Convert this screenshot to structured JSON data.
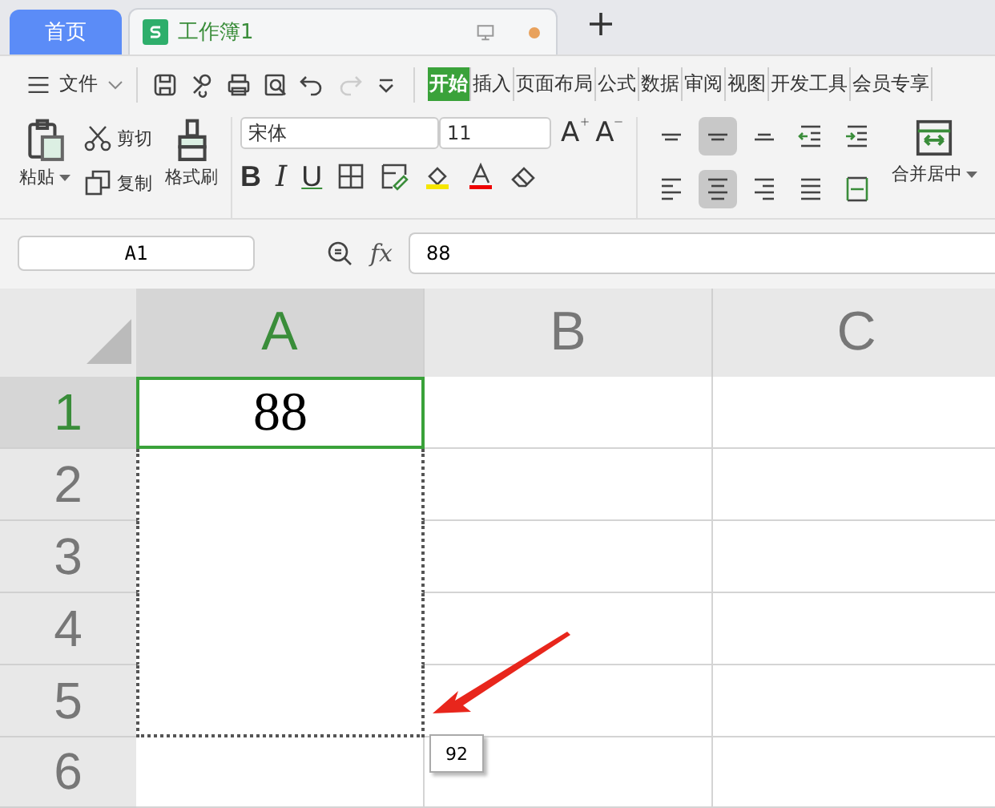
{
  "tabs": [
    {
      "label": "首页",
      "kind": "home",
      "selected": false
    },
    {
      "label": "工作簿1",
      "kind": "workbook",
      "selected": true,
      "modified": true
    }
  ],
  "menu": {
    "file": "文件",
    "ribbon_tabs": [
      {
        "label": "开始",
        "selected": true
      },
      {
        "label": "插入",
        "selected": false
      },
      {
        "label": "页面布局",
        "selected": false
      },
      {
        "label": "公式",
        "selected": false
      },
      {
        "label": "数据",
        "selected": false
      },
      {
        "label": "审阅",
        "selected": false
      },
      {
        "label": "视图",
        "selected": false
      },
      {
        "label": "开发工具",
        "selected": false
      },
      {
        "label": "会员专享",
        "selected": false
      }
    ]
  },
  "ribbon": {
    "paste": "粘贴",
    "cut": "剪切",
    "copy": "复制",
    "format_painter": "格式刷",
    "font_name": "宋体",
    "font_size": "11",
    "grow_font": "A",
    "shrink_font": "A",
    "bold": "B",
    "italic": "I",
    "underline": "U",
    "merge": "合并居中",
    "alignment": [
      {
        "kind": "top",
        "selected": false
      },
      {
        "kind": "middle",
        "selected": true
      },
      {
        "kind": "bottom",
        "selected": false
      },
      {
        "kind": "outdent",
        "selected": false
      },
      {
        "kind": "indent",
        "selected": false
      },
      {
        "kind": "left",
        "selected": false
      },
      {
        "kind": "center",
        "selected": true
      },
      {
        "kind": "right",
        "selected": false
      },
      {
        "kind": "justify",
        "selected": false
      },
      {
        "kind": "distributed",
        "selected": false
      }
    ]
  },
  "formula_bar": {
    "name_box": "A1",
    "fx": "fx",
    "value": "88"
  },
  "grid": {
    "columns": [
      {
        "label": "A",
        "selected": true
      },
      {
        "label": "B",
        "selected": false
      },
      {
        "label": "C",
        "selected": false
      }
    ],
    "rows": [
      {
        "label": "1",
        "selected": true,
        "in_fill_range": true,
        "cell_a": "88"
      },
      {
        "label": "2",
        "selected": false,
        "in_fill_range": true
      },
      {
        "label": "3",
        "selected": false,
        "in_fill_range": true
      },
      {
        "label": "4",
        "selected": false,
        "in_fill_range": true
      },
      {
        "label": "5",
        "selected": false,
        "in_fill_range": true
      },
      {
        "label": "6",
        "selected": false,
        "in_fill_range": false
      }
    ],
    "fill_tooltip": "92"
  }
}
